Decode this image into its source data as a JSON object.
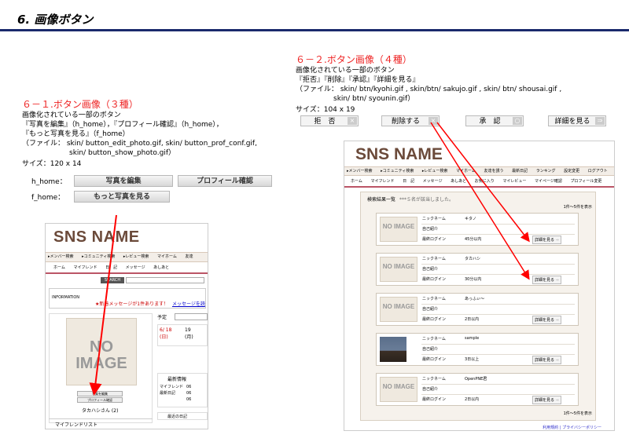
{
  "page": {
    "title": "6. 画像ボタン"
  },
  "section1": {
    "heading": "６－１.ボタン画像（３種）",
    "lines": [
      "画像化されている一部のボタン",
      "『写真を編集』（h_home），『プロフィール確認』（h_home），",
      "『もっと写真を見る』（f_home）",
      "（ファイル： skin/ button_edit_photo.gif, skin/ button_prof_conf.gif,",
      "skin/ button_show_photo.gif）",
      "サイズ：120 x 14"
    ],
    "h_home_label": "h_home：",
    "f_home_label": "f_home：",
    "btn_edit_photo": "写真を編集",
    "btn_prof_conf": "プロフィール確認",
    "btn_show_photo": "もっと写真を見る"
  },
  "section2": {
    "heading": "６－２.ボタン画像（４種）",
    "lines": [
      "画像化されている一部のボタン",
      "『拒否』『削除』『承認』『詳細を見る』",
      "（ファイル： skin/ btn/kyohi.gif , skin/btn/ sakujo.gif , skin/ btn/ shousai.gif ,",
      "skin/ btn/ syounin.gif）",
      "サイズ：104 x 19"
    ],
    "buttons": [
      {
        "label": "拒　否",
        "icon": "×"
      },
      {
        "label": "削除する",
        "icon": "×"
      },
      {
        "label": "承　認",
        "icon": "○"
      },
      {
        "label": "詳細を見る",
        "icon": "⇒"
      }
    ]
  },
  "shot_left": {
    "logo": "SNS NAME",
    "nav1": [
      "▸メンバー検索",
      "▸コミュニティ検索",
      "▸レビュー検索",
      "マイホーム",
      "友達"
    ],
    "nav2": [
      "ホーム",
      "マイフレンド",
      "日　記",
      "メッセージ",
      "あしあと"
    ],
    "search_btn": "SEARCH",
    "info_label": "INFORMATION",
    "info_text": "★新着メッセージが1件あります！",
    "info_link": "メッセージを読",
    "noimage": "NO IMAGE",
    "btn_edit": "写真を編集",
    "btn_prof": "プロフィール確認",
    "user_name": "タカハシさん (2)",
    "schedule": "予定",
    "date1": "6/ 18 (日)",
    "date2": "19 (月)",
    "latest_info": "最新情報",
    "friend_diary": "マイフレンド最新日記",
    "diary_rows": [
      "06",
      "06",
      "06"
    ],
    "friend_list": "マイフレンドリスト",
    "recent_diary": "最近の日記"
  },
  "shot_right": {
    "logo": "SNS NAME",
    "nav1": [
      "▸メンバー検索",
      "▸コミュニティ検索",
      "▸レビュー検索",
      "マイホーム",
      "友達を誘う",
      "最新日記",
      "ランキング",
      "設定変更",
      "ログアウト"
    ],
    "nav2": [
      "ホーム",
      "マイフレンド",
      "日　記",
      "メッセージ",
      "あしあと",
      "お気に入り",
      "マイレビュー",
      "マイページ確認",
      "プロフィール変更"
    ],
    "result_header": "検索結果一覧",
    "result_note": "***５名が該当しました。",
    "paging": "1件～5件を表示",
    "noimage": "NO IMAGE",
    "label_nick": "ニックネーム",
    "label_intro": "自己紹介",
    "label_login": "最終ログイン",
    "detail_btn": "詳細を見る",
    "results": [
      {
        "nick": "キタノ",
        "login": "45分以内",
        "photo": false
      },
      {
        "nick": "タカハシ",
        "login": "30分以内",
        "photo": false
      },
      {
        "nick": "あっふぃ～",
        "login": "2日以内",
        "photo": false
      },
      {
        "nick": "sample",
        "login": "3日以上",
        "photo": true
      },
      {
        "nick": "OpenPNE君",
        "login": "2日以内",
        "photo": false
      }
    ],
    "footer_links": "利用規約 | プライバシーポリシー"
  },
  "colors": {
    "heading_red": "#e22222",
    "title_bar": "#1a2a6c",
    "arrow_red": "#ff0000",
    "logo_brown": "#6b4a3a"
  }
}
